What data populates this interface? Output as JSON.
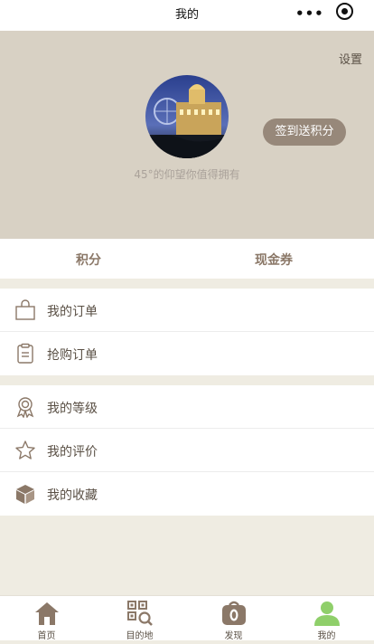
{
  "header": {
    "title": "我的"
  },
  "profile": {
    "settings_label": "设置",
    "signin_label": "签到送积分",
    "slogan": "45°的仰望你值得拥有"
  },
  "tabs": [
    {
      "label": "积分"
    },
    {
      "label": "现金券"
    }
  ],
  "menu_group_1": [
    {
      "label": "我的订单",
      "icon": "shopping-bag-icon"
    },
    {
      "label": "抢购订单",
      "icon": "clipboard-icon"
    }
  ],
  "menu_group_2": [
    {
      "label": "我的等级",
      "icon": "badge-icon"
    },
    {
      "label": "我的评价",
      "icon": "star-icon"
    },
    {
      "label": "我的收藏",
      "icon": "box-icon"
    }
  ],
  "bottom_nav": [
    {
      "label": "首页",
      "icon": "home-icon"
    },
    {
      "label": "目的地",
      "icon": "qr-search-icon"
    },
    {
      "label": "发现",
      "icon": "camera-icon"
    },
    {
      "label": "我的",
      "icon": "user-icon",
      "active": true
    }
  ],
  "colors": {
    "profile_bg": "#d8d1c4",
    "accent_brown": "#97887a",
    "active_green": "#8fcf6a",
    "icon_brown": "#8b7868"
  }
}
